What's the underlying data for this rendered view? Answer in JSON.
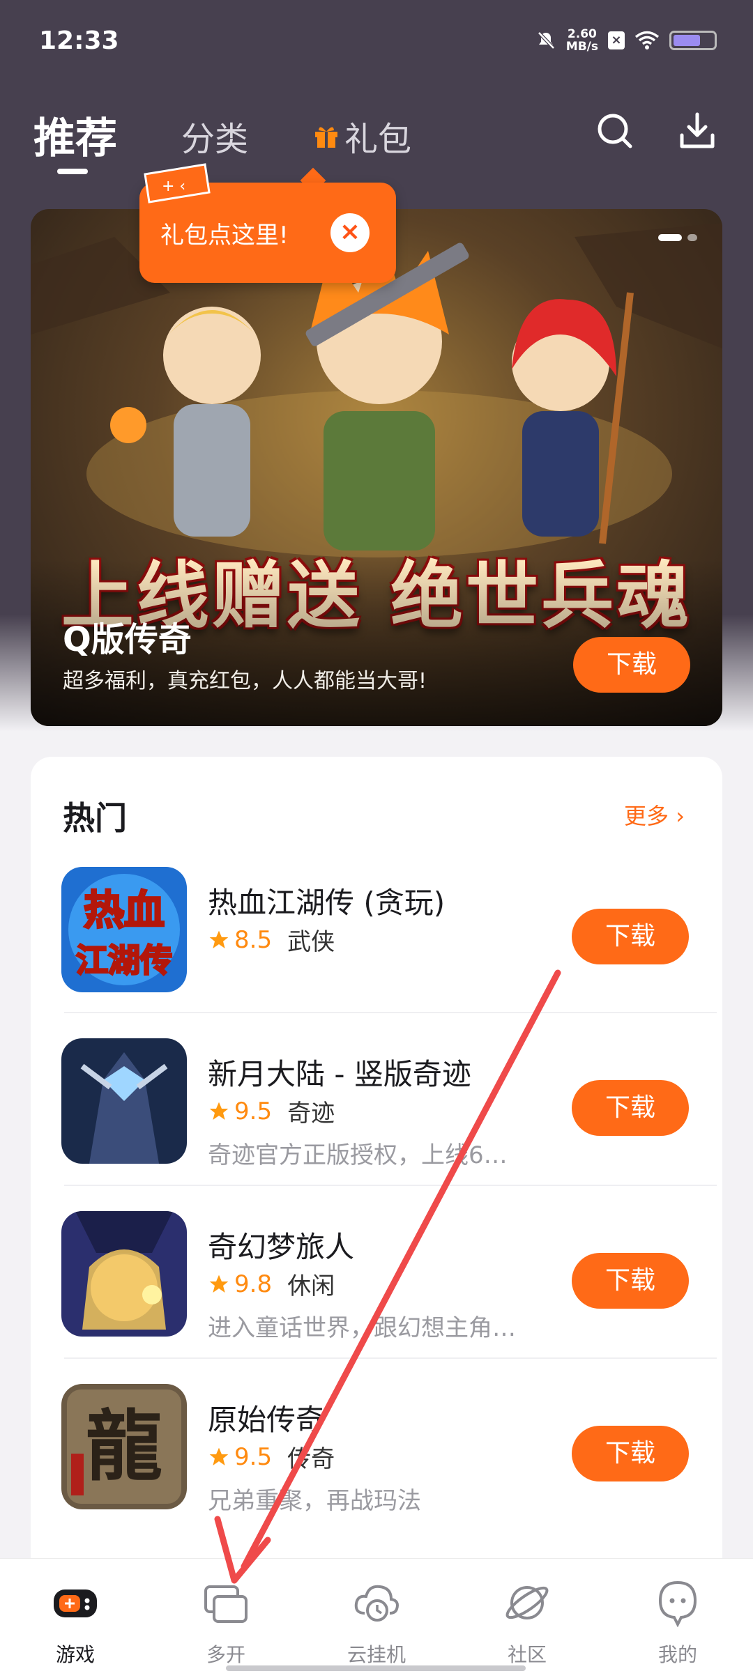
{
  "status_bar": {
    "time": "12:33",
    "net_speed_value": "2.60",
    "net_speed_unit": "MB/s"
  },
  "header": {
    "tabs": [
      {
        "label": "推荐",
        "active": true
      },
      {
        "label": "分类",
        "active": false
      },
      {
        "label": "礼包",
        "active": false
      }
    ],
    "search_icon": "search-icon",
    "download_icon": "download-icon"
  },
  "tooltip": {
    "text": "礼包点这里!",
    "close_icon": "close-icon"
  },
  "banner": {
    "slogan": "上线赠送 绝世兵魂",
    "title": "Q版传奇",
    "subtitle": "超多福利，真充红包，人人都能当大哥!",
    "download_label": "下载"
  },
  "hot": {
    "title": "热门",
    "more_label": "更多 ›",
    "games": [
      {
        "name": "热血江湖传 (贪玩)",
        "score": "8.5",
        "category": "武侠",
        "desc": "",
        "download_label": "下载"
      },
      {
        "name": "新月大陆 - 竖版奇迹",
        "score": "9.5",
        "category": "奇迹",
        "desc": "奇迹官方正版授权，上线6…",
        "download_label": "下载"
      },
      {
        "name": "奇幻梦旅人",
        "score": "9.8",
        "category": "休闲",
        "desc": "进入童话世界，跟幻想主角…",
        "download_label": "下载"
      },
      {
        "name": "原始传奇",
        "score": "9.5",
        "category": "传奇",
        "desc": "兄弟重聚，再战玛法",
        "download_label": "下载"
      }
    ]
  },
  "bottom_nav": [
    {
      "label": "游戏",
      "icon": "gamepad-icon",
      "active": true
    },
    {
      "label": "多开",
      "icon": "multi-window-icon",
      "active": false
    },
    {
      "label": "云挂机",
      "icon": "cloud-clock-icon",
      "active": false
    },
    {
      "label": "社区",
      "icon": "planet-icon",
      "active": false
    },
    {
      "label": "我的",
      "icon": "profile-icon",
      "active": false
    }
  ],
  "colors": {
    "accent": "#ff6a17",
    "header_bg": "#47404f",
    "score": "#ff8a10",
    "annotation_arrow": "#ef4a4a"
  }
}
